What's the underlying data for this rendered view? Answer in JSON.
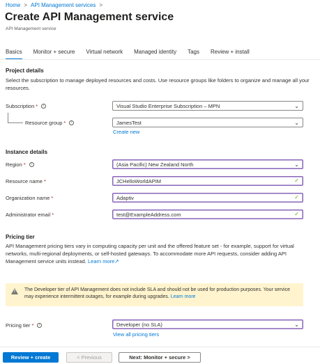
{
  "breadcrumb": {
    "home": "Home",
    "sep1": ">",
    "service": "API Management services",
    "sep2": ">"
  },
  "header": {
    "title": "Create API Management service",
    "more": "...",
    "subtitle": "API Management service"
  },
  "tabs": [
    {
      "label": "Basics",
      "active": true
    },
    {
      "label": "Monitor + secure"
    },
    {
      "label": "Virtual network"
    },
    {
      "label": "Managed identity"
    },
    {
      "label": "Tags"
    },
    {
      "label": "Review + install"
    }
  ],
  "project": {
    "title": "Project details",
    "description": "Select the subscription to manage deployed resources and costs. Use resource groups like folders to organize and manage all your resources.",
    "subscription_label": "Subscription",
    "subscription_value": "Visual Studio Enterprise Subscription – MPN",
    "resource_group_label": "Resource group",
    "resource_group_value": "JamesTest",
    "create_new": "Create new"
  },
  "instance": {
    "title": "Instance details",
    "region_label": "Region",
    "region_value": "(Asia Pacific) New Zealand North",
    "resource_name_label": "Resource name",
    "resource_name_value": "JCHelloWorldAPIM",
    "org_name_label": "Organization name",
    "org_name_value": "Adaptiv",
    "admin_email_label": "Administrator email",
    "admin_email_value": "test@ExampleAddress.com"
  },
  "pricing": {
    "title": "Pricing tier",
    "description": "API Management pricing tiers vary in computing capacity per unit and the offered feature set - for example, support for virtual networks, multi-regional deployments, or self-hosted gateways. To accommodate more API requests, consider adding API Management service units instead.",
    "learn_more": "Learn more",
    "warning_text": "The Developer tier of API Management does not include SLA and should not be used for production purposes. Your service may experience intermittent outages, for example during upgrades.",
    "warning_link": "Learn more",
    "tier_label": "Pricing tier",
    "tier_value": "Developer (no SLA)",
    "view_all": "View all pricing tiers"
  },
  "common": {
    "required": "*",
    "info": "i",
    "chevron": "⌄",
    "check": "✓",
    "ext": "↗",
    "warn": "!"
  },
  "footer": {
    "review_create": "Review + create",
    "previous": "< Previous",
    "next": "Next: Monitor + secure >"
  },
  "colors": {
    "accent": "#0078d4",
    "focus_border": "#8764b8",
    "valid_check": "#57a300",
    "warning_bg": "#fff4ce",
    "required": "#a4262c"
  }
}
